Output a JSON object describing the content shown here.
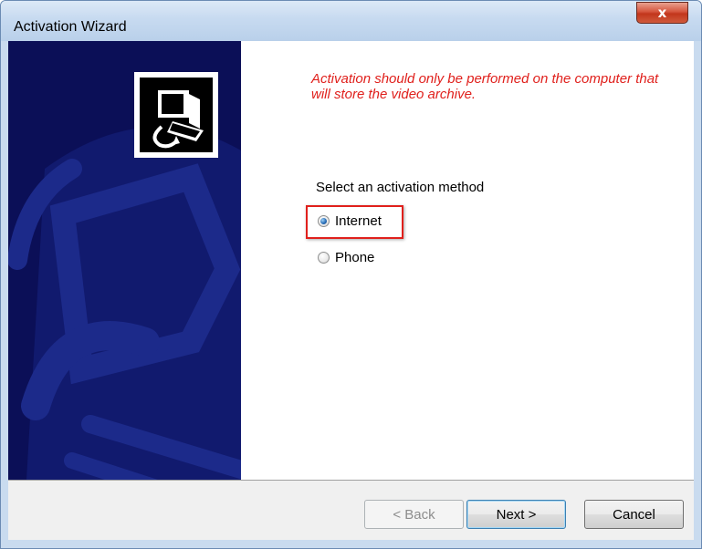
{
  "window": {
    "title": "Activation Wizard",
    "close_glyph": "x"
  },
  "header": {
    "warning": "Activation should only be performed on the computer that will store the video archive."
  },
  "activation": {
    "prompt": "Select an activation method",
    "options": [
      {
        "label": "Internet",
        "selected": true
      },
      {
        "label": "Phone",
        "selected": false
      }
    ]
  },
  "buttons": {
    "back": "< Back",
    "next": "Next >",
    "cancel": "Cancel"
  },
  "colors": {
    "side_panel": "#0b0f57",
    "warning_text": "#e0201c",
    "highlight": "#e0201c"
  },
  "icons": {
    "logo": "computer-return-icon"
  }
}
